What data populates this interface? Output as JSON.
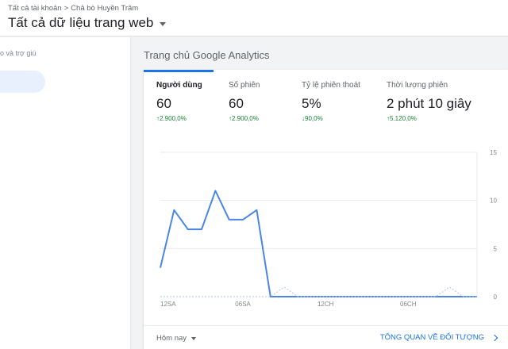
{
  "breadcrumb": {
    "account": "Tất cả tài khoản",
    "separator": ">",
    "property": "Chả bò Huyền Trâm"
  },
  "view_selector": {
    "label": "Tất cả dữ liệu trang web",
    "icon": "caret-down-icon"
  },
  "sidebar": {
    "help_text": "o và trợ giú"
  },
  "card": {
    "header": "Trang chủ Google Analytics",
    "metrics": [
      {
        "label": "Người dùng",
        "value": "60",
        "change": "2.900,0%",
        "direction": "up"
      },
      {
        "label": "Số phiên",
        "value": "60",
        "change": "2.900,0%",
        "direction": "up"
      },
      {
        "label": "Tỷ lệ phiên thoát",
        "value": "5%",
        "change": "90,0%",
        "direction": "down"
      },
      {
        "label": "Thời lượng phiên",
        "value": "2 phút 10 giây",
        "change": "5.120,0%",
        "direction": "up"
      }
    ],
    "footer": {
      "date_range": "Hôm nay",
      "overview_link": "TỔNG QUAN VỀ ĐỐI TƯỢNG",
      "link_icon": "chevron-right-icon"
    }
  },
  "colors": {
    "accent": "#1a73e8",
    "positive": "#188038",
    "primary_series": "#4a86e8",
    "comparison_series": "#b8cdf3"
  },
  "chart_data": {
    "type": "line",
    "x_ticks": [
      "12SA",
      "06SA",
      "12CH",
      "06CH"
    ],
    "x_tick_hours": [
      0,
      6,
      12,
      18
    ],
    "y_ticks": [
      0,
      5,
      10,
      15
    ],
    "ylim": [
      0,
      15
    ],
    "grid": true,
    "series": [
      {
        "x": [
          0,
          1,
          2,
          3,
          4,
          5,
          6,
          7,
          8,
          9,
          10,
          11,
          12,
          13,
          14,
          15,
          16,
          17,
          18,
          19,
          20,
          21,
          22,
          23
        ],
        "values": [
          3,
          9,
          7,
          7,
          11,
          8,
          8,
          9,
          0,
          0,
          0,
          0,
          0,
          0,
          0,
          0,
          0,
          0,
          0,
          0,
          0,
          0,
          0,
          0
        ],
        "style": "solid"
      },
      {
        "x": [
          0,
          1,
          2,
          3,
          4,
          5,
          6,
          7,
          8,
          9,
          10,
          11,
          12,
          13,
          14,
          15,
          16,
          17,
          18,
          19,
          20,
          21,
          22,
          23
        ],
        "values": [
          0,
          0,
          0,
          0,
          0,
          0,
          0,
          0,
          0,
          1,
          0,
          0,
          0,
          0,
          0,
          0,
          0,
          0,
          0,
          0,
          0,
          1,
          0,
          0
        ],
        "style": "dotted"
      }
    ]
  }
}
